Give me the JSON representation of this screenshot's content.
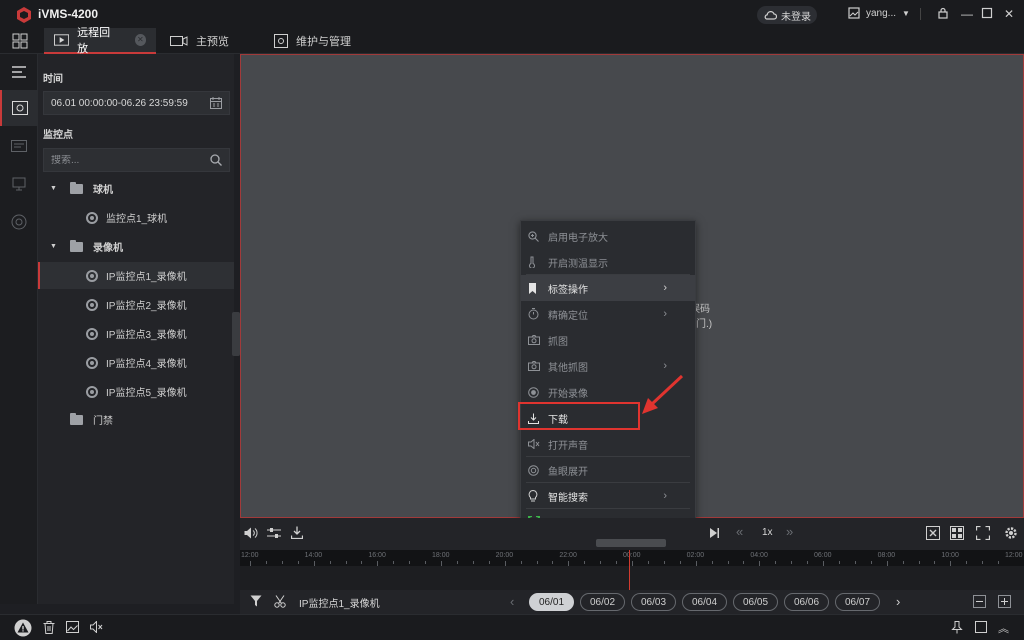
{
  "app": {
    "title": "iVMS-4200",
    "brand_color": "#c93a3a"
  },
  "titlebar": {
    "login_label": "未登录",
    "user_label": "yang..."
  },
  "tabs": [
    {
      "label": "远程回放"
    },
    {
      "label": "主预览"
    },
    {
      "label": "维护与管理"
    }
  ],
  "left_panel": {
    "time_label": "时间",
    "time_range": "06.01 00:00:00-06.26 23:59:59",
    "monitor_label": "监控点",
    "search_placeholder": "搜索...",
    "tree": [
      {
        "label": "球机",
        "type": "group"
      },
      {
        "label": "监控点1_球机",
        "type": "camera"
      },
      {
        "label": "录像机",
        "type": "group"
      },
      {
        "label": "IP监控点1_录像机",
        "type": "camera",
        "selected": true
      },
      {
        "label": "IP监控点2_录像机",
        "type": "camera"
      },
      {
        "label": "IP监控点3_录像机",
        "type": "camera"
      },
      {
        "label": "IP监控点4_录像机",
        "type": "camera"
      },
      {
        "label": "IP监控点5_录像机",
        "type": "camera"
      },
      {
        "label": "门禁",
        "type": "group"
      }
    ]
  },
  "video": {
    "overlay_line1": "误码",
    "overlay_line2": "门.)"
  },
  "context_menu": {
    "items": [
      {
        "label": "启用电子放大",
        "icon": "zoom-icon"
      },
      {
        "label": "开启测温显示",
        "icon": "thermometer-icon"
      },
      {
        "label": "标签操作",
        "icon": "bookmark-icon",
        "submenu": true
      },
      {
        "label": "精确定位",
        "icon": "timer-icon",
        "submenu": true
      },
      {
        "label": "抓图",
        "icon": "camera-icon"
      },
      {
        "label": "其他抓图",
        "icon": "camera-icon",
        "submenu": true
      },
      {
        "label": "开始录像",
        "icon": "record-icon"
      },
      {
        "label": "下载",
        "icon": "download-icon"
      },
      {
        "label": "打开声音",
        "icon": "mute-icon"
      },
      {
        "label": "鱼眼展开",
        "icon": "fisheye-icon"
      },
      {
        "label": "智能搜索",
        "icon": "bulb-icon",
        "submenu": true
      },
      {
        "label": "全屏",
        "icon": "fullscreen-icon"
      }
    ]
  },
  "controls": {
    "speed": "1x"
  },
  "timeline": {
    "ticks": [
      "12:00",
      "14:00",
      "16:00",
      "18:00",
      "20:00",
      "22:00",
      "00:00",
      "02:00",
      "04:00",
      "06:00",
      "08:00",
      "10:00",
      "12:00"
    ]
  },
  "datebar": {
    "channel_label": "IP监控点1_录像机",
    "dates": [
      "06/01",
      "06/02",
      "06/03",
      "06/04",
      "06/05",
      "06/06",
      "06/07"
    ]
  }
}
